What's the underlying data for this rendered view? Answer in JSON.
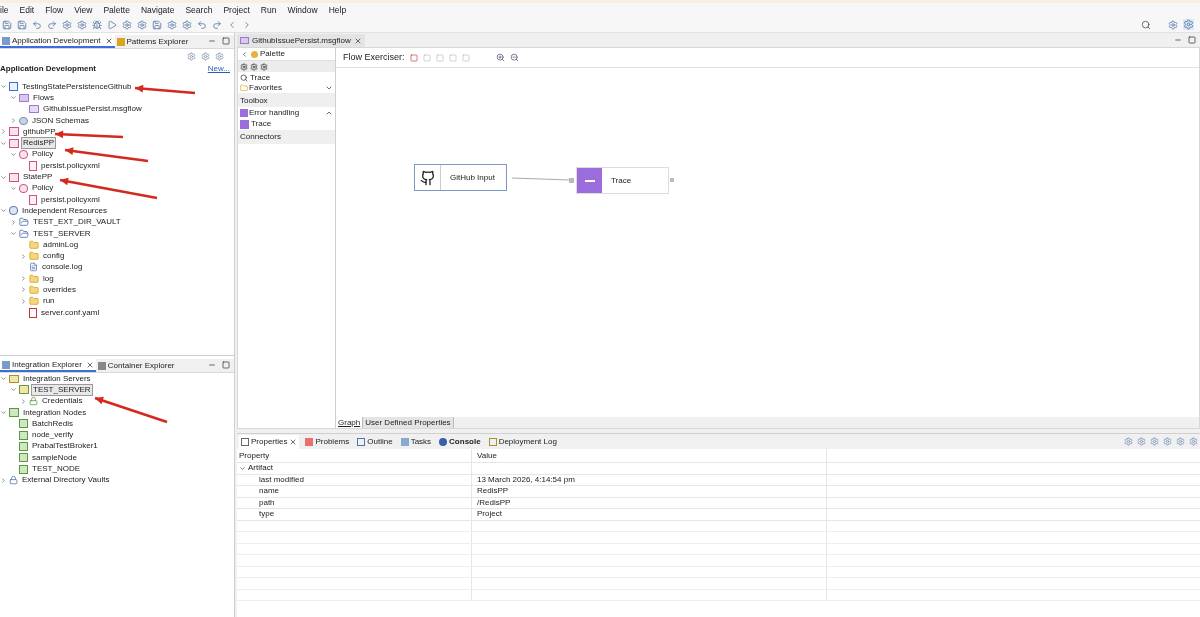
{
  "menu": [
    "ile",
    "Edit",
    "Flow",
    "View",
    "Palette",
    "Navigate",
    "Search",
    "Project",
    "Run",
    "Window",
    "Help"
  ],
  "left_top": {
    "tabs": [
      {
        "label": "Application Development",
        "selected": true
      },
      {
        "label": "Patterns Explorer",
        "selected": false
      }
    ],
    "header": "Application Development",
    "new_link": "New...",
    "tree": [
      {
        "label": "TestingStatePersistenceGithub",
        "kind": "app",
        "expanded": true,
        "selected": false,
        "children": [
          {
            "label": "Flows",
            "kind": "flows",
            "expanded": true,
            "selected": false,
            "children": [
              {
                "label": "GithubIssuePersist.msgflow",
                "kind": "msgflow",
                "selected": false
              }
            ]
          },
          {
            "label": "JSON Schemas",
            "kind": "schemas",
            "expanded": false,
            "selected": false
          }
        ]
      },
      {
        "label": "githubPP",
        "kind": "policyproject",
        "expanded": false,
        "selected": false
      },
      {
        "label": "RedisPP",
        "kind": "policyproject",
        "expanded": true,
        "selected": true,
        "children": [
          {
            "label": "Policy",
            "kind": "policy",
            "expanded": true,
            "selected": false,
            "children": [
              {
                "label": "persist.policyxml",
                "kind": "policyfile",
                "selected": false
              }
            ]
          }
        ]
      },
      {
        "label": "StatePP",
        "kind": "policyproject",
        "expanded": true,
        "selected": false,
        "children": [
          {
            "label": "Policy",
            "kind": "policy",
            "expanded": true,
            "selected": false,
            "children": [
              {
                "label": "persist.policyxml",
                "kind": "policyfile",
                "selected": false
              }
            ]
          }
        ]
      },
      {
        "label": "Independent Resources",
        "kind": "resources",
        "expanded": true,
        "selected": false,
        "children": [
          {
            "label": "TEST_EXT_DIR_VAULT",
            "kind": "openfolder",
            "expanded": false,
            "selected": false
          },
          {
            "label": "TEST_SERVER",
            "kind": "openfolder",
            "expanded": true,
            "selected": false,
            "children": [
              {
                "label": "adminLog",
                "kind": "folder",
                "selected": false
              },
              {
                "label": "config",
                "kind": "folder",
                "expanded": false,
                "selected": false
              },
              {
                "label": "console.log",
                "kind": "file",
                "selected": false
              },
              {
                "label": "log",
                "kind": "folder",
                "expanded": false,
                "selected": false
              },
              {
                "label": "overrides",
                "kind": "folder",
                "expanded": false,
                "selected": false
              },
              {
                "label": "run",
                "kind": "folder",
                "expanded": false,
                "selected": false
              },
              {
                "label": "server.conf.yaml",
                "kind": "yaml",
                "selected": false
              }
            ]
          }
        ]
      }
    ]
  },
  "left_bottom": {
    "tabs": [
      {
        "label": "Integration Explorer",
        "selected": true
      },
      {
        "label": "Container Explorer",
        "selected": false
      }
    ],
    "tree": [
      {
        "label": "Integration Servers",
        "kind": "servers",
        "expanded": true,
        "selected": false,
        "children": [
          {
            "label": "TEST_SERVER",
            "kind": "server",
            "expanded": true,
            "selected": true,
            "children": [
              {
                "label": "Credentials",
                "kind": "credentials",
                "expanded": false,
                "selected": false
              }
            ]
          }
        ]
      },
      {
        "label": "Integration Nodes",
        "kind": "nodes",
        "expanded": true,
        "selected": false,
        "children": [
          {
            "label": "BatchRedis",
            "kind": "node",
            "selected": false
          },
          {
            "label": "node_verify",
            "kind": "node",
            "selected": false
          },
          {
            "label": "PrabalTestBroker1",
            "kind": "node",
            "selected": false
          },
          {
            "label": "sampleNode",
            "kind": "node",
            "selected": false
          },
          {
            "label": "TEST_NODE",
            "kind": "node",
            "selected": false
          }
        ]
      },
      {
        "label": "External Directory Vaults",
        "kind": "vault",
        "expanded": false,
        "selected": false
      }
    ]
  },
  "editor": {
    "tab": "GithubIssuePersist.msgflow",
    "palette": {
      "title": "Palette",
      "search": "Trace",
      "favorites": "Favorites",
      "toolbox": "Toolbox",
      "drawer": {
        "label": "Error handling",
        "expanded": true
      },
      "item": "Trace",
      "connectors": "Connectors"
    },
    "flow_exerciser": "Flow Exerciser:",
    "nodes": [
      {
        "label": "GitHub Input",
        "kind": "github"
      },
      {
        "label": "Trace",
        "kind": "trace"
      }
    ],
    "bottom_tabs": [
      {
        "label": "Graph",
        "selected": true
      },
      {
        "label": "User Defined Properties",
        "selected": false
      }
    ]
  },
  "properties": {
    "tabs": [
      {
        "label": "Properties",
        "kind": "properties",
        "selected": true
      },
      {
        "label": "Problems",
        "kind": "problems",
        "selected": false
      },
      {
        "label": "Outline",
        "kind": "outline",
        "selected": false
      },
      {
        "label": "Tasks",
        "kind": "tasks",
        "selected": false
      },
      {
        "label": "Console",
        "kind": "console",
        "selected": false
      },
      {
        "label": "Deployment Log",
        "kind": "log",
        "selected": false
      }
    ],
    "columns": [
      "Property",
      "Value"
    ],
    "group": {
      "label": "Artifact",
      "expanded": true
    },
    "rows": [
      {
        "property": "last modified",
        "value": "13 March 2026, 4:14:54 pm"
      },
      {
        "property": "name",
        "value": "RedisPP"
      },
      {
        "property": "path",
        "value": "/RedisPP"
      },
      {
        "property": "type",
        "value": "Project"
      }
    ]
  }
}
